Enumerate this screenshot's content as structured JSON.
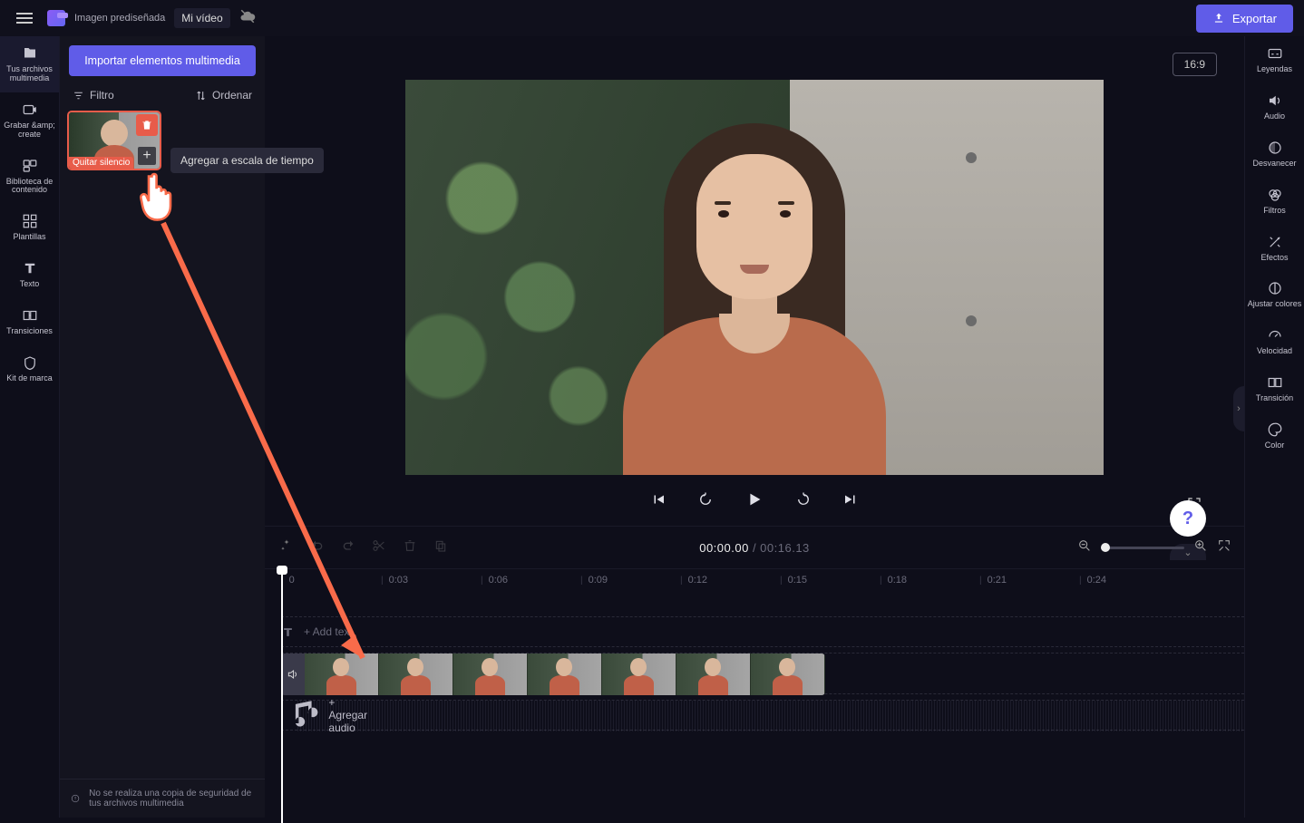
{
  "header": {
    "preset_label": "Imagen prediseñada",
    "project_name": "Mi vídeo",
    "export_label": "Exportar",
    "aspect_ratio": "16:9"
  },
  "left_rail": {
    "items": [
      {
        "label": "Tus archivos multimedia"
      },
      {
        "label": "Grabar &amp; create"
      },
      {
        "label": "Biblioteca de contenido"
      },
      {
        "label": "Plantillas"
      },
      {
        "label": "Texto"
      },
      {
        "label": "Transiciones"
      },
      {
        "label": "Kit de marca"
      }
    ]
  },
  "media_panel": {
    "import_label": "Importar elementos multimedia",
    "filter_label": "Filtro",
    "sort_label": "Ordenar",
    "thumb_badge": "Quitar silencio",
    "tooltip": "Agregar a escala de tiempo",
    "backup_msg": "No se realiza una copia de seguridad de tus archivos multimedia"
  },
  "right_rail": {
    "items": [
      {
        "label": "Leyendas"
      },
      {
        "label": "Audio"
      },
      {
        "label": "Desvanecer"
      },
      {
        "label": "Filtros"
      },
      {
        "label": "Efectos"
      },
      {
        "label": "Ajustar colores"
      },
      {
        "label": "Velocidad"
      },
      {
        "label": "Transición"
      },
      {
        "label": "Color"
      }
    ]
  },
  "tools": {
    "timecode_current": "00:00.00",
    "timecode_sep": " / ",
    "timecode_duration": "00:16.13"
  },
  "ruler": {
    "marks": [
      "0",
      "0:03",
      "0:06",
      "0:09",
      "0:12",
      "0:15",
      "0:18",
      "0:21",
      "0:24"
    ]
  },
  "tracks": {
    "text_hint": "+ Add text",
    "audio_hint": "+  Agregar audio"
  }
}
